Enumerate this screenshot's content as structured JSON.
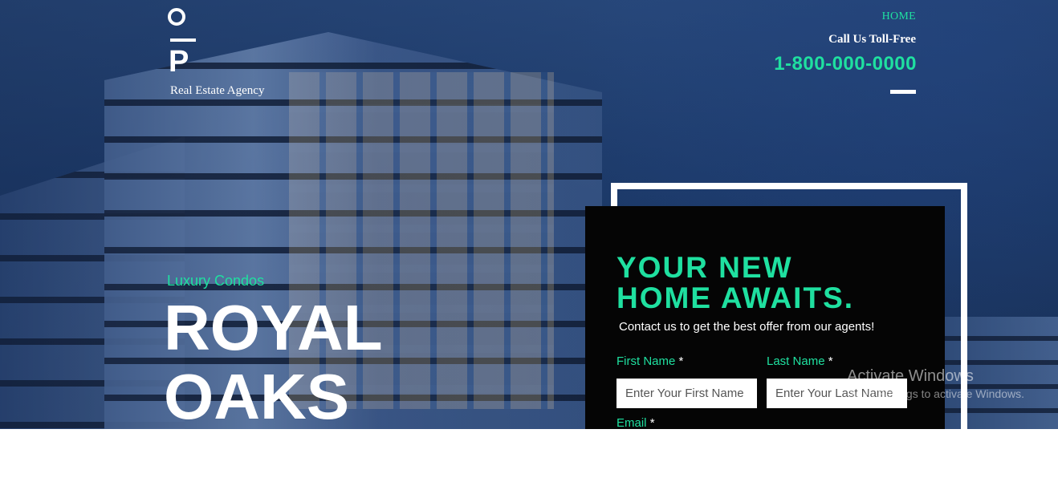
{
  "header": {
    "logo": {
      "letter_top": "O",
      "letter_bottom": "P",
      "tagline": "Real Estate Agency"
    },
    "nav": {
      "home": "HOME"
    },
    "contact": {
      "label": "Call Us Toll-Free",
      "phone": "1-800-000-0000"
    }
  },
  "hero": {
    "subtitle": "Luxury Condos",
    "title_line1": "ROYAL",
    "title_line2": "OAKS"
  },
  "form": {
    "heading_line1": "YOUR NEW",
    "heading_line2": "HOME AWAITS.",
    "subheading": "Contact us to get the best offer from our agents!",
    "required_mark": "*",
    "first_name": {
      "label": "First Name",
      "placeholder": "Enter Your First Name"
    },
    "last_name": {
      "label": "Last Name",
      "placeholder": "Enter Your Last Name"
    },
    "email": {
      "label": "Email"
    }
  },
  "watermark": {
    "title": "Activate Windows",
    "subtitle": "Go to Settings to activate Windows."
  },
  "colors": {
    "accent": "#1fe0a0",
    "card_bg": "#050505",
    "text_light": "#ffffff"
  }
}
